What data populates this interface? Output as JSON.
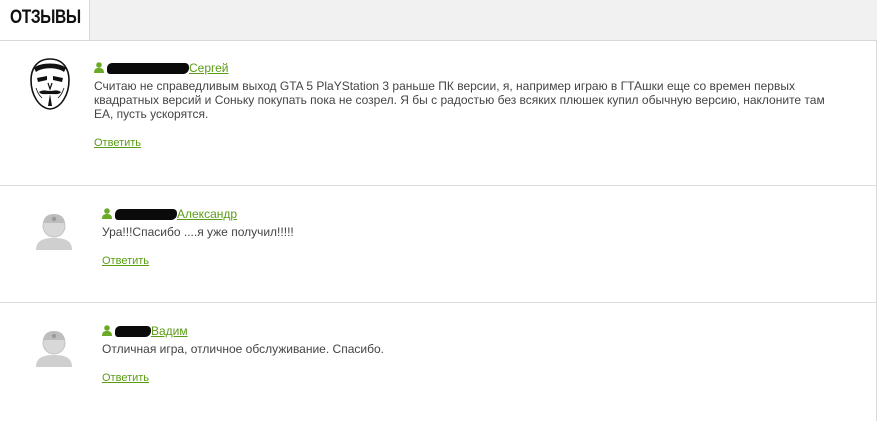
{
  "tabs": {
    "reviews_label": "ОТЗЫВЫ"
  },
  "colors": {
    "link": "#5a9c15",
    "text": "#444444",
    "divider": "#dcdcdc"
  },
  "reviews": [
    {
      "author": "Сергей",
      "avatar": "anonymous-mask-icon",
      "text": "Считаю не справедливым выход GTA 5 PlaYStation 3 раньше ПК версии, я, например играю в ГТАшки еще со времен первых квадратных версий и Соньку покупать пока не созрел. Я бы с радостью без всяких плюшек купил обычную версию, наклоните там ЕА, пусть ускорятся.",
      "reply": "Ответить"
    },
    {
      "author": "Александр",
      "avatar": "default-user-avatar-icon",
      "text": "Ура!!!Спасибо ....я уже получил!!!!!",
      "reply": "Ответить"
    },
    {
      "author": "Вадим",
      "avatar": "default-user-avatar-icon",
      "text": "Отличная игра, отличное обслуживание. Спасибо.",
      "reply": "Ответить"
    }
  ]
}
